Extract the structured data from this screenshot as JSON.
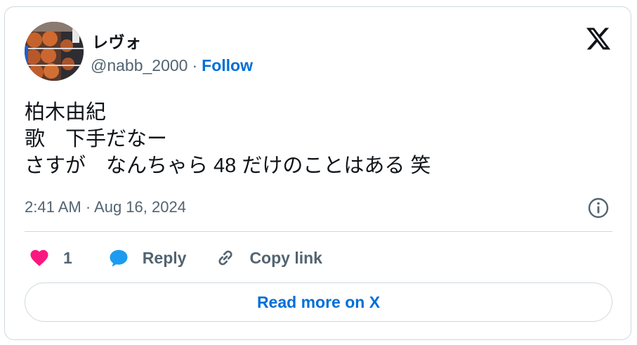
{
  "user": {
    "display_name": "レヴォ",
    "handle": "@nabb_2000",
    "separator": "·",
    "follow_label": "Follow",
    "avatar_icon": "basketball-rack-photo"
  },
  "brand": {
    "logo_icon": "x-logo-icon"
  },
  "tweet": {
    "lines": [
      "柏木由紀",
      "歌　下手だなー",
      "さすが　なんちゃら 48 だけのことはある 笑"
    ],
    "timestamp": "2:41 AM · Aug 16, 2024"
  },
  "actions": {
    "like_count": "1",
    "reply_label": "Reply",
    "copy_label": "Copy link"
  },
  "footer": {
    "read_more_label": "Read more on X"
  },
  "colors": {
    "text_primary": "#0f1419",
    "text_secondary": "#536471",
    "link_blue": "#006fd6",
    "heart_pink": "#f91880",
    "reply_blue": "#1d9bf0",
    "border": "#cfd9de"
  }
}
